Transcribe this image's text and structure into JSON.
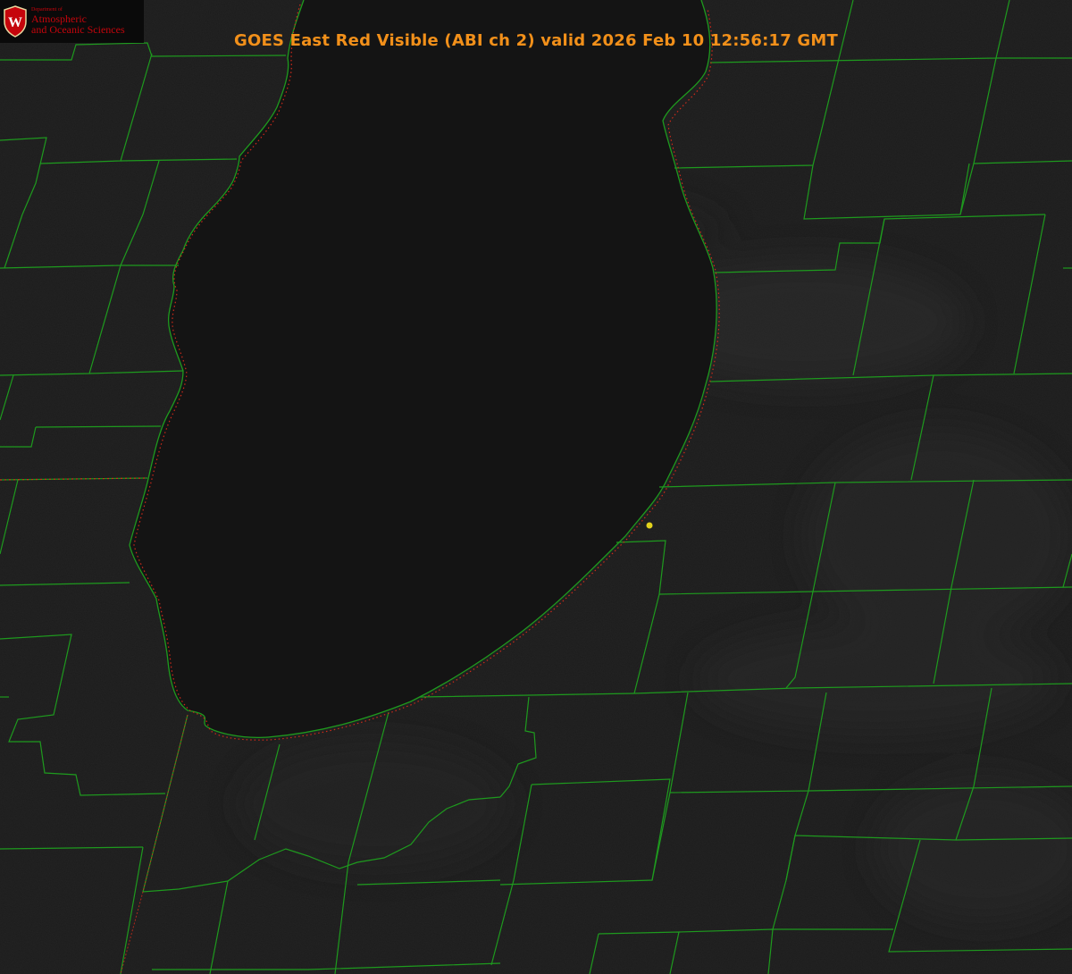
{
  "title": "GOES East Red Visible (ABI ch 2) valid 2026 Feb 10 12:56:17 GMT",
  "logo": {
    "dept": "Department of",
    "line1": "Atmospheric",
    "line2": "and Oceanic Sciences",
    "seal_letter": "W"
  },
  "colors": {
    "background": "#1a1a1a",
    "lake": "#121212",
    "county_lines": "#1e9a1e",
    "shoreline_dots": "#d02a1a",
    "title": "#f2901a",
    "marker": "#e2d21c",
    "logo_red": "#c5050c"
  },
  "icons": [
    "uw-crest-icon",
    "station-marker-icon"
  ]
}
